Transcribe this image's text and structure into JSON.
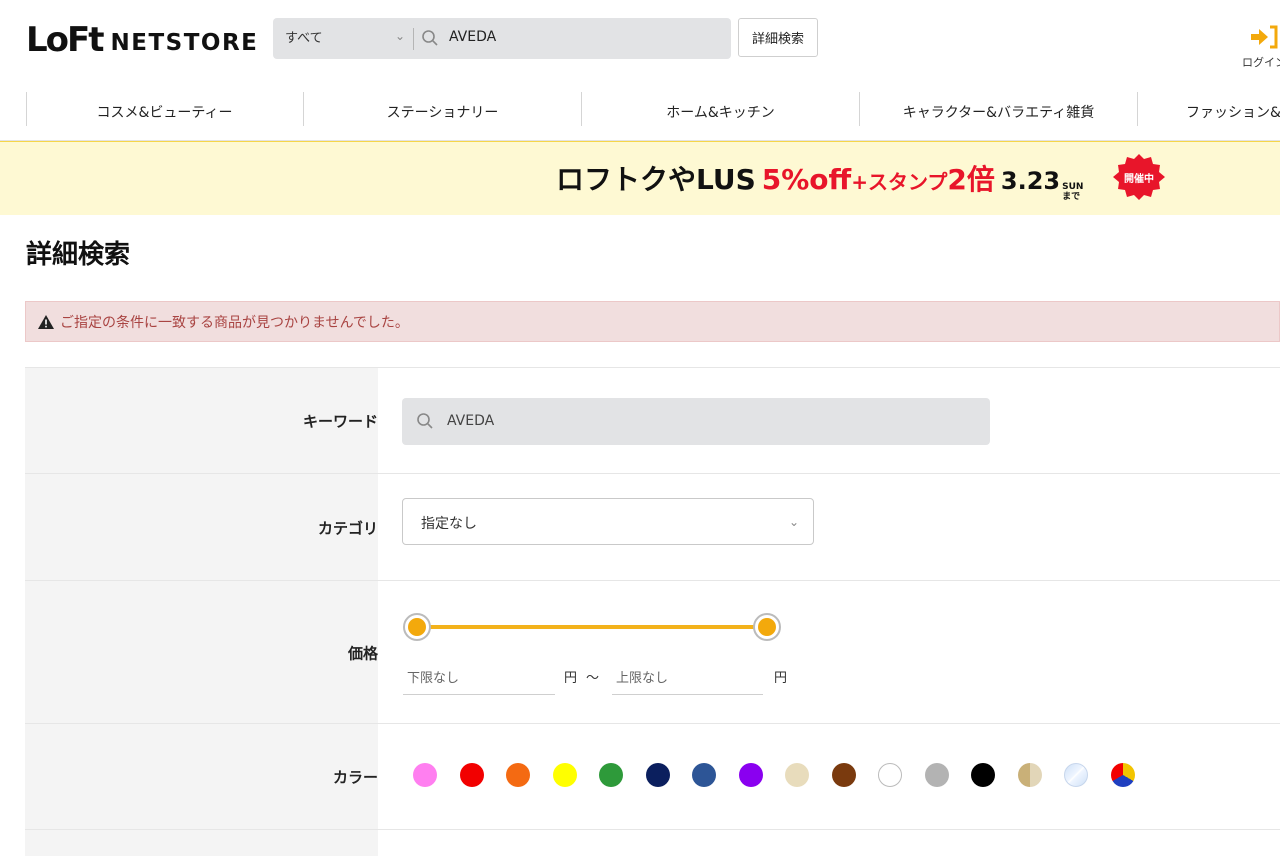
{
  "header": {
    "logo_mark": "LoFt",
    "logo_text": "NETSTORE",
    "search_scope": "すべて",
    "search_value": "AVEDA",
    "advanced_button": "詳細検索",
    "login_label": "ログイン"
  },
  "nav": {
    "items": [
      {
        "label": "コスメ&ビューティー"
      },
      {
        "label": "ステーショナリー"
      },
      {
        "label": "ホーム&キッチン"
      },
      {
        "label": "キャラクター&バラエティ雑貨"
      },
      {
        "label": "ファッション&"
      }
    ]
  },
  "banner": {
    "part1": "ロフトク",
    "part2": "やLUS",
    "discount": "5%off",
    "plus": "+スタンプ",
    "double": "2倍",
    "date": "3.23",
    "day": "SUN",
    "until": "まで",
    "badge": "開催中"
  },
  "page": {
    "title": "詳細検索",
    "alert": "ご指定の条件に一致する商品が見つかりませんでした。"
  },
  "form": {
    "keyword_label": "キーワード",
    "keyword_value": "AVEDA",
    "category_label": "カテゴリ",
    "category_value": "指定なし",
    "price_label": "価格",
    "price_min_placeholder": "下限なし",
    "price_max_placeholder": "上限なし",
    "yen": "円",
    "tilde": "〜",
    "color_label": "カラー"
  },
  "colors": [
    {
      "name": "pink",
      "hex": "#ff7ff0"
    },
    {
      "name": "red",
      "hex": "#f20000"
    },
    {
      "name": "orange",
      "hex": "#f46a12"
    },
    {
      "name": "yellow",
      "hex": "#ffff00"
    },
    {
      "name": "green",
      "hex": "#2e9a3a"
    },
    {
      "name": "navy",
      "hex": "#0b1f5e"
    },
    {
      "name": "blue",
      "hex": "#2d5596"
    },
    {
      "name": "purple",
      "hex": "#8a00f0"
    },
    {
      "name": "beige",
      "hex": "#e8dcbc"
    },
    {
      "name": "brown",
      "hex": "#7a3a0e"
    },
    {
      "name": "white",
      "hex": "#ffffff"
    },
    {
      "name": "gray",
      "hex": "#b3b3b3"
    },
    {
      "name": "black",
      "hex": "#000000"
    },
    {
      "name": "gold",
      "hex": "#cbb68a"
    },
    {
      "name": "clear",
      "hex": "#d9e8fb"
    },
    {
      "name": "multi",
      "hex": "#f20000"
    }
  ]
}
